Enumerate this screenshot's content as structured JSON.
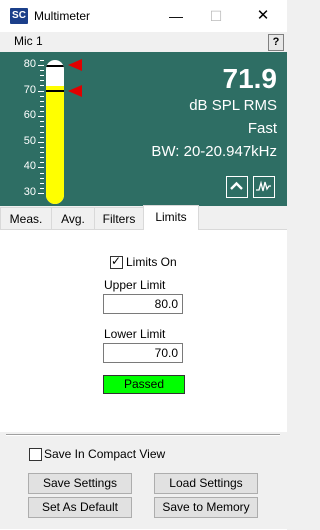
{
  "window": {
    "title": "Multimeter",
    "app_icon_text": "SC",
    "min_glyph": "—",
    "max_glyph": "☐",
    "close_glyph": "✕"
  },
  "mic": {
    "label": "Mic 1",
    "help": "?"
  },
  "meter": {
    "scale_ticks": [
      "80",
      "70",
      "60",
      "50",
      "40",
      "30"
    ],
    "level_db": 71.9,
    "upper_limit": 80,
    "lower_limit": 70,
    "value": "71.9",
    "unit": "dB SPL RMS",
    "response": "Fast",
    "bandwidth": "BW: 20-20.947kHz",
    "colors": {
      "panel": "#2e6e64",
      "bar": "#ffff00",
      "limit_marker": "#e00000"
    },
    "icons": [
      "chevron-up-icon",
      "waveform-icon"
    ]
  },
  "tabs": [
    {
      "label": "Meas.",
      "active": false
    },
    {
      "label": "Avg.",
      "active": false
    },
    {
      "label": "Filters",
      "active": false
    },
    {
      "label": "Limits",
      "active": true
    }
  ],
  "limits": {
    "limits_on_label": "Limits On",
    "limits_on_checked": true,
    "upper_label": "Upper Limit",
    "upper_value": "80.0",
    "lower_label": "Lower Limit",
    "lower_value": "70.0",
    "status": "Passed",
    "status_color": "#00ff00"
  },
  "footer": {
    "compact_label": "Save In Compact View",
    "compact_checked": false,
    "save_settings": "Save Settings",
    "load_settings": "Load Settings",
    "set_default": "Set As Default",
    "save_memory": "Save to Memory"
  }
}
